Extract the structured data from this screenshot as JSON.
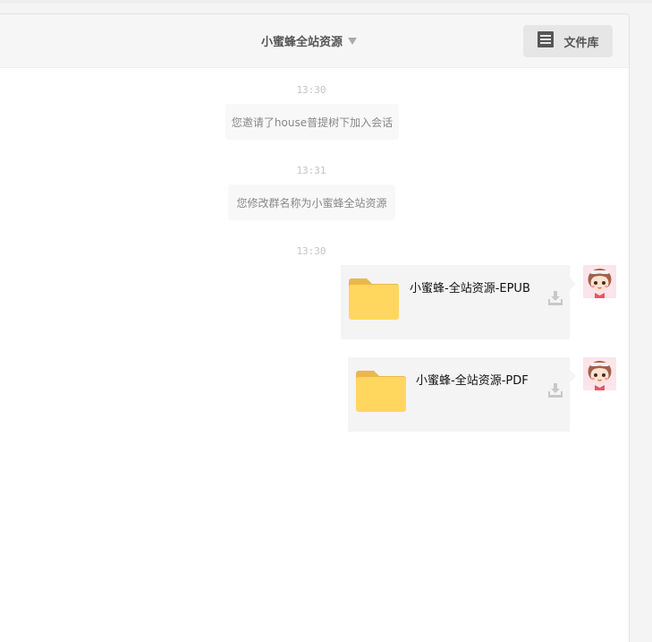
{
  "header": {
    "group_name": "小蜜蜂全站资源",
    "library_label": "文件库"
  },
  "messages": [
    {
      "type": "time",
      "text": "13:30"
    },
    {
      "type": "system",
      "text": "您邀请了house普提树下加入会话"
    },
    {
      "type": "time",
      "text": "13:31"
    },
    {
      "type": "system",
      "text": "您修改群名称为小蜜蜂全站资源"
    },
    {
      "type": "time",
      "text": "13:30"
    },
    {
      "type": "file",
      "name": "小蜜蜂-全站资源-EPUB"
    },
    {
      "type": "file",
      "name": "小蜜蜂-全站资源-PDF"
    }
  ],
  "icons": {
    "library": "document-list-icon",
    "caret": "caret-down-icon",
    "folder": "folder-icon",
    "download": "download-icon"
  },
  "colors": {
    "folder": "#ffd75e",
    "folder_tab": "#eab84a",
    "bubble": "#f4f4f4",
    "header": "#f6f6f6"
  }
}
